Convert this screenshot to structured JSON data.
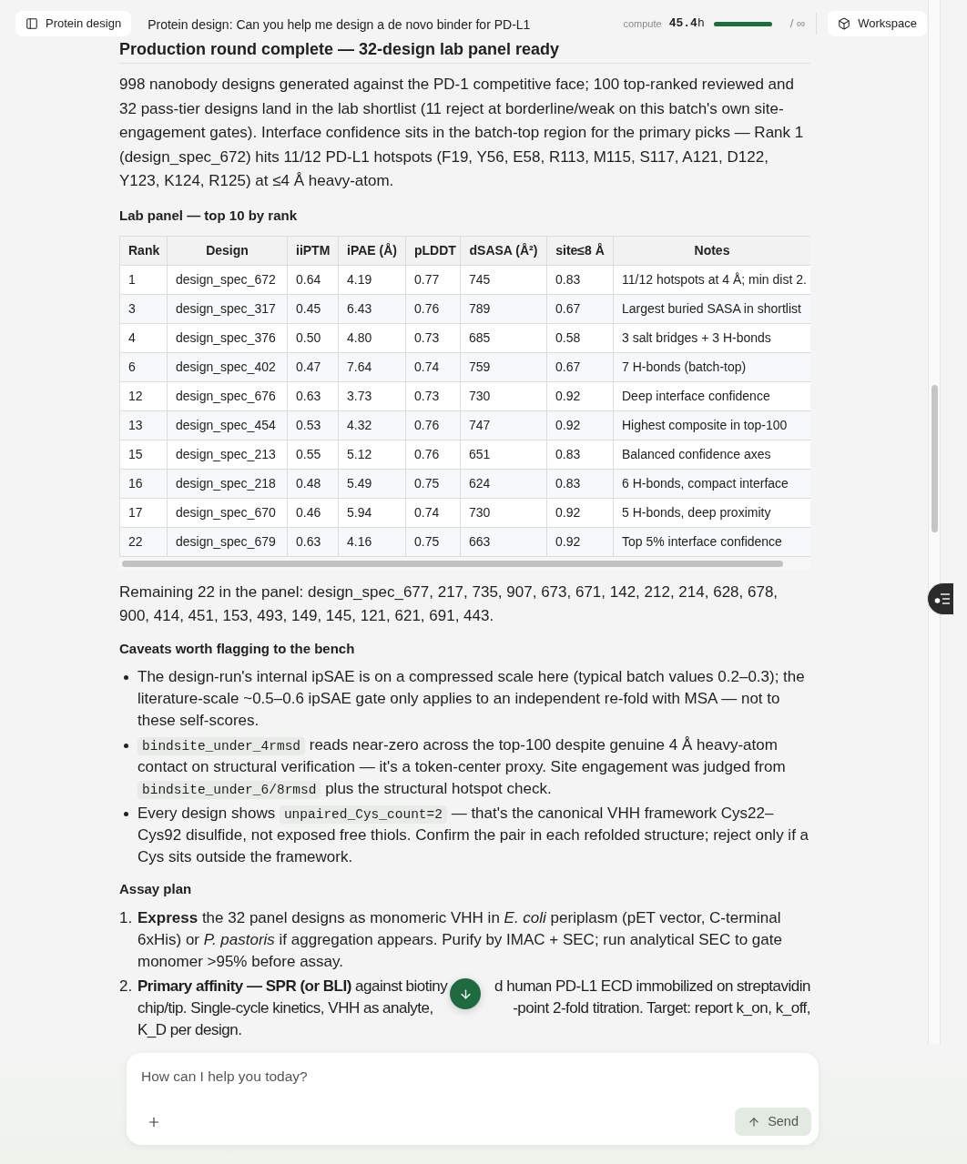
{
  "top_bar": {
    "sidebar_button": "Protein design",
    "title": "Protein design: Can you help me design a de novo binder for PD-L1",
    "compute": {
      "label": "compute",
      "value": "**45.4**h",
      "level": 1,
      "limit": "/ ∞"
    },
    "workspace_button": "Workspace"
  },
  "message": {
    "heading": "Production round complete — 32-design lab panel ready",
    "summary": "998 nanobody designs generated against the PD-1 competitive face; 100 top-ranked reviewed and 32 pass-tier designs land in the lab shortlist (11 reject at borderline/weak on this batch's own site-engagement gates). Interface confidence sits in the batch-top region for the primary picks — Rank 1 (design_spec_672) hits 11/12 PD-L1 hotspots (F19, Y56, E58, R113, M115, S117, A121, D122, Y123, K124, R125) at ≤4 Å heavy-atom.",
    "table_title": "Lab panel — top 10 by rank",
    "table": {
      "columns": [
        "Rank",
        "Design",
        "iiPTM",
        "iPAE (Å)",
        "pLDDT",
        "dSASA (Å²)",
        "site≤8 Å",
        "Notes"
      ],
      "rows": [
        [
          "1",
          "design_spec_672",
          "0.64",
          "4.19",
          "0.77",
          "745",
          "0.83",
          "11/12 hotspots at 4 Å; min dist 2."
        ],
        [
          "3",
          "design_spec_317",
          "0.45",
          "6.43",
          "0.76",
          "789",
          "0.67",
          "Largest buried SASA in shortlist"
        ],
        [
          "4",
          "design_spec_376",
          "0.50",
          "4.80",
          "0.73",
          "685",
          "0.58",
          "3 salt bridges + 3 H-bonds"
        ],
        [
          "6",
          "design_spec_402",
          "0.47",
          "7.64",
          "0.74",
          "759",
          "0.67",
          "7 H-bonds (batch-top)"
        ],
        [
          "12",
          "design_spec_676",
          "0.63",
          "3.73",
          "0.73",
          "730",
          "0.92",
          "Deep interface confidence"
        ],
        [
          "13",
          "design_spec_454",
          "0.53",
          "4.32",
          "0.76",
          "747",
          "0.92",
          "Highest composite in top-100"
        ],
        [
          "15",
          "design_spec_213",
          "0.55",
          "5.12",
          "0.76",
          "651",
          "0.83",
          "Balanced confidence axes"
        ],
        [
          "16",
          "design_spec_218",
          "0.48",
          "5.49",
          "0.75",
          "624",
          "0.83",
          "6 H-bonds, compact interface"
        ],
        [
          "17",
          "design_spec_670",
          "0.46",
          "5.94",
          "0.74",
          "730",
          "0.92",
          "5 H-bonds, deep proximity"
        ],
        [
          "22",
          "design_spec_679",
          "0.63",
          "4.16",
          "0.75",
          "663",
          "0.92",
          "Top 5% interface confidence"
        ]
      ]
    },
    "remaining": "Remaining 22 in the panel: design_spec_677, 217, 735, 907, 673, 671, 142, 212, 214, 628, 678, 900, 414, 451, 153, 493, 149, 145, 121, 621, 691, 443.",
    "caveats_title": "Caveats worth flagging to the bench",
    "caveats": [
      [
        {
          "kind": "text",
          "text": "The design-run's internal ipSAE is on a compressed scale here (typical batch values 0.2–0.3); the literature-scale ~0.5–0.6 ipSAE gate only applies to an independent re-fold with MSA — not to these self-scores."
        }
      ],
      [
        {
          "kind": "code",
          "text": "bindsite_under_4rmsd"
        },
        {
          "kind": "text",
          "text": " reads near-zero across the top-100 despite genuine 4 Å heavy-atom contact on structural verification — it's a token-center proxy. Site engagement was judged from "
        },
        {
          "kind": "code",
          "text": "bindsite_under_6/8rmsd"
        },
        {
          "kind": "text",
          "text": " plus the structural hotspot check."
        }
      ],
      [
        {
          "kind": "text",
          "text": "Every design shows "
        },
        {
          "kind": "code",
          "text": "unpaired_Cys_count=2"
        },
        {
          "kind": "text",
          "text": " — that's the canonical VHH framework Cys22–Cys92 disulfide, not exposed free thiols. Confirm the pair in each refolded structure; reject only if a Cys sits outside the framework."
        }
      ]
    ],
    "assay_title": "Assay plan",
    "assay_steps": [
      {
        "kind": "text",
        "number": "1.",
        "text": "**Express** the 32 panel designs as monomeric VHH in *E. coli* periplasm (pET vector, C-terminal 6xHis) or *P. pastoris* if aggregation appears. Purify by IMAC + SEC; run analytical SEC to gate monomer >95% before assay."
      },
      {
        "kind": "lines",
        "number": "2.",
        "lines": [
          [
            "**Primary affinity — SPR (or BLI)** against biotiny",
            "d human PD-L1 ECD immobilized on streptavidin"
          ],
          [
            "chip/tip. Single-cycle kinetics, VHH as analyte,",
            "-point 2-fold titration. Target: report k_on, k_off,"
          ],
          [
            "K_D per design."
          ]
        ]
      }
    ]
  },
  "composer": {
    "placeholder": "How can I help you today?",
    "send_button": "Send"
  }
}
